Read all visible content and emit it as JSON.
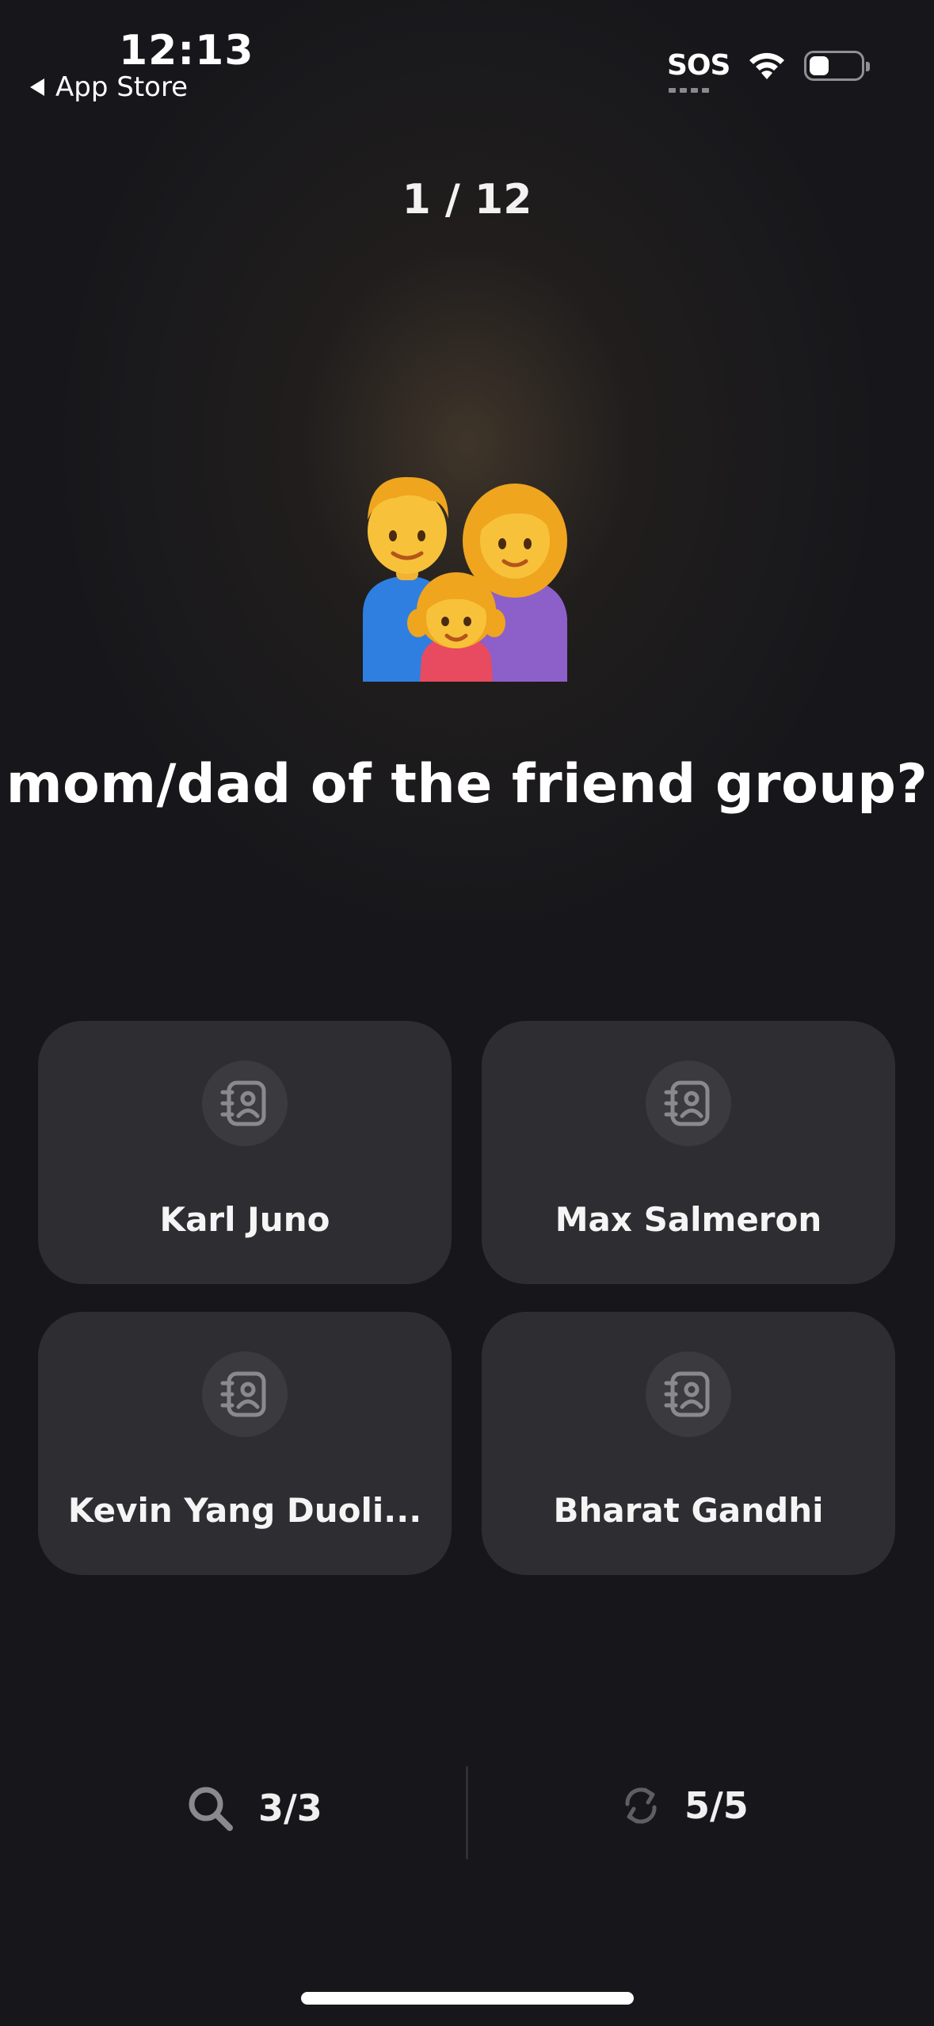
{
  "status_bar": {
    "time": "12:13",
    "back_label": "App Store",
    "sos": "SOS"
  },
  "progress": "1 / 12",
  "question": {
    "emoji_icon": "family-emoji-icon",
    "text": "mom/dad of the friend group?"
  },
  "options": [
    {
      "name": "Karl Juno",
      "icon": "contact-book-icon"
    },
    {
      "name": "Max Salmeron",
      "icon": "contact-book-icon"
    },
    {
      "name": "Kevin Yang Duoli...",
      "icon": "contact-book-icon"
    },
    {
      "name": "Bharat Gandhi",
      "icon": "contact-book-icon"
    }
  ],
  "bottom_bar": {
    "search_count": "3/3",
    "shuffle_count": "5/5"
  },
  "colors": {
    "background": "#17171b",
    "card": "#2e2e32",
    "icon_circle": "#3a3a3f",
    "muted_icon": "#8a8a8e"
  }
}
